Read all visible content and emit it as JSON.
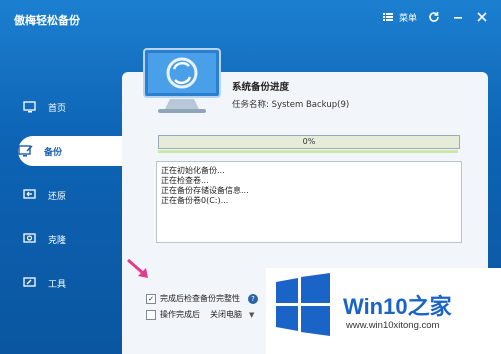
{
  "window": {
    "title": "傲梅轻松备份"
  },
  "titlebar": {
    "menu_label": "菜单"
  },
  "sidebar": {
    "items": [
      {
        "label": "首页",
        "icon": "home-monitor-icon",
        "active": false
      },
      {
        "label": "备份",
        "icon": "backup-icon",
        "active": true
      },
      {
        "label": "还原",
        "icon": "restore-icon",
        "active": false
      },
      {
        "label": "克隆",
        "icon": "clone-icon",
        "active": false
      },
      {
        "label": "工具",
        "icon": "tools-icon",
        "active": false
      }
    ]
  },
  "main": {
    "title": "系统备份进度",
    "task_name": "任务名称: System Backup(9)",
    "progress_percent": 0,
    "progress_text": "0%",
    "log_lines": [
      "正在初始化备份...",
      "正在检查卷...",
      "正在备份存储设备信息...",
      "正在备份卷0(C:)..."
    ],
    "options": {
      "verify_label": "完成后检查备份完整性",
      "verify_checked": true,
      "after_label": "操作完成后",
      "after_checked": false,
      "after_value": "关闭电脑"
    }
  },
  "watermark": {
    "brand": "Win10",
    "brand_zh": "之家",
    "url": "www.win10xitong.com"
  },
  "colors": {
    "accent": "#1a64c8",
    "window_blue": "#0d63b4",
    "progress_green": "#9fd36a",
    "arrow_pink": "#e23a8c"
  }
}
